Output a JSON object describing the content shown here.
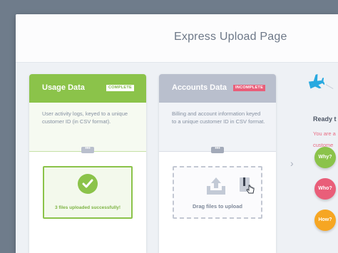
{
  "header": {
    "title": "Express Upload Page"
  },
  "cards": [
    {
      "title": "Usage Data",
      "status": "COMPLETE",
      "description": "User activity logs, keyed to a unique customer ID (in CSV format).",
      "grip": "•••",
      "result": "3 files uploaded successfully!"
    },
    {
      "title": "Accounts Data",
      "status": "INCOMPLETE",
      "description": "Billing and account information keyed to a unique customer ID in CSV format.",
      "grip": "•••",
      "prompt": "Drag files to upload"
    }
  ],
  "next_arrow": "›",
  "ready": {
    "title": "Ready t",
    "line1": "You are a",
    "line2": "custome"
  },
  "help_buttons": [
    "Why?",
    "Who?",
    "How?"
  ],
  "colors": {
    "complete": "#8bc34a",
    "incomplete": "#e95e79",
    "how": "#f6a623",
    "neutral": "#b9bfcd"
  },
  "icons": [
    "check-icon",
    "upload-icon",
    "file-icon",
    "cursor-hand-icon",
    "airplane-icon",
    "chevron-right-icon"
  ]
}
